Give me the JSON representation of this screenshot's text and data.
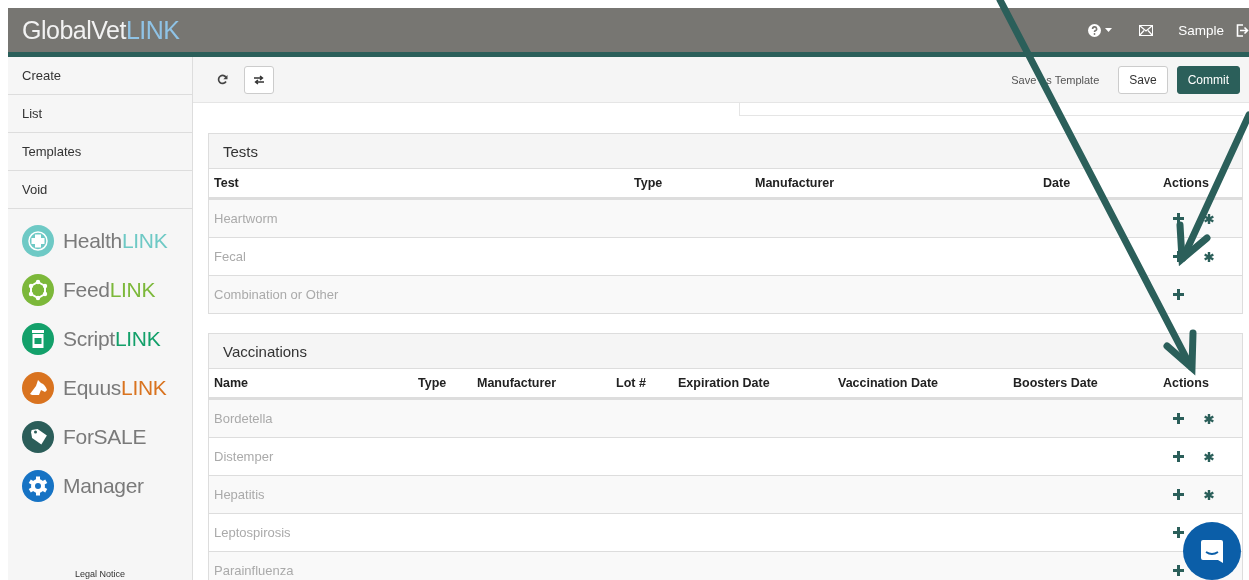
{
  "header": {
    "logo": {
      "name": "GlobalVet",
      "suffix": "LINK"
    },
    "user": "Sample"
  },
  "sidebar": {
    "nav": [
      {
        "label": "Create"
      },
      {
        "label": "List"
      },
      {
        "label": "Templates"
      },
      {
        "label": "Void"
      }
    ],
    "apps": [
      {
        "name": "Health",
        "suffix": "LINK",
        "color": "#6ec9c5"
      },
      {
        "name": "Feed",
        "suffix": "LINK",
        "color": "#7cb83a"
      },
      {
        "name": "Script",
        "suffix": "LINK",
        "color": "#13a06a"
      },
      {
        "name": "Equus",
        "suffix": "LINK",
        "color": "#d9731f"
      },
      {
        "name": "ForSALE",
        "color": "#2b5d59"
      },
      {
        "name": "Manager",
        "color": "#1673c4"
      }
    ],
    "footer": "Legal Notice"
  },
  "toolbar": {
    "save_template": [
      "Save",
      "s Template"
    ],
    "save": "Save",
    "commit": "Commit"
  },
  "panels": [
    {
      "kind": "tests",
      "title": "Tests",
      "columns": [
        "Test",
        "Type",
        "Manufacturer",
        "Date",
        "Actions"
      ],
      "rows": [
        {
          "name": "Heartworm",
          "editable": true
        },
        {
          "name": "Fecal",
          "editable": true
        },
        {
          "name": "Combination or Other",
          "editable": false
        }
      ]
    },
    {
      "kind": "vaccinations",
      "title": "Vaccinations",
      "columns": [
        "Name",
        "Type",
        "Manufacturer",
        "Lot #",
        "Expiration Date",
        "Vaccination Date",
        "Boosters Date",
        "Actions"
      ],
      "rows": [
        {
          "name": "Bordetella",
          "editable": true
        },
        {
          "name": "Distemper",
          "editable": true
        },
        {
          "name": "Hepatitis",
          "editable": true
        },
        {
          "name": "Leptospirosis",
          "editable": false
        },
        {
          "name": "Parainfluenza",
          "editable": false
        }
      ]
    }
  ]
}
